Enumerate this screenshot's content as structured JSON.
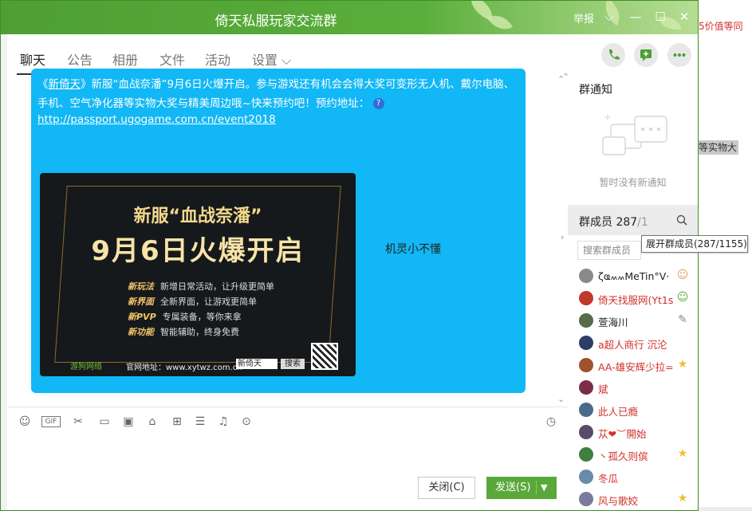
{
  "background": {
    "right_text": "5价值等同",
    "right_highlight": "等实物大"
  },
  "window": {
    "title": "倚天私服玩家交流群",
    "report_label": "举报",
    "controls": {
      "menu": "⌵",
      "minimize": "—",
      "maximize": "☐",
      "close": "✕"
    }
  },
  "tabs": [
    {
      "label": "聊天"
    },
    {
      "label": "公告"
    },
    {
      "label": "相册"
    },
    {
      "label": "文件"
    },
    {
      "label": "活动"
    },
    {
      "label": "设置 ⌵"
    }
  ],
  "message": {
    "text_prefix": "《",
    "game_name": "新倚天",
    "text_body": "》新服“血战奈潘”9月6日火爆开启。参与游戏还有机会会得大奖可变形无人机、戴尔电脑、手机、空气净化器等实物大奖与精美周边哦~快来预约吧！预约地址：",
    "link": "http://passport.ugogame.com.cn/event2018",
    "banner": {
      "headline": "新服“血战奈潘”",
      "subheadline": "9月6日火爆开启",
      "features": [
        {
          "name": "新玩法",
          "desc": "新增日常活动，让升级更简单"
        },
        {
          "name": "新界面",
          "desc": "全新界面，让游戏更简单"
        },
        {
          "name": "新PVP",
          "desc": "专属装备，等你来拿"
        },
        {
          "name": "新功能",
          "desc": "智能辅助，终身免费"
        }
      ],
      "brand": "游狗网络",
      "site": "官网地址：www.xytwz.com.cn",
      "search_value": "新倚天",
      "search_button": "搜索"
    },
    "sender": "机灵小不懂"
  },
  "composer": {
    "close_label": "关闭(C)",
    "send_label": "发送(S)",
    "tools": [
      "smile-icon",
      "gif-icon",
      "scissors-icon",
      "folder-icon",
      "image-icon",
      "store-icon",
      "gift-icon",
      "calendar-icon",
      "bell-icon",
      "more-icon"
    ]
  },
  "sidebar": {
    "notice_title": "群通知",
    "notice_empty": "暂时没有新通知",
    "member_title": "群成员 287",
    "member_count_suffix": "/1",
    "search_placeholder": "搜索群成员",
    "tooltip": "展开群成员(287/1155)",
    "members": [
      {
        "name": "ζҩ៳៳MeTin°V·",
        "color": "black",
        "avatar": "#8a8a8a",
        "badge": "owner"
      },
      {
        "name": "倚天找服网(Yt1s",
        "color": "red",
        "avatar": "#c0392b",
        "badge": "owner"
      },
      {
        "name": "萱海川",
        "color": "black",
        "avatar": "#556b4a",
        "badge": "edit"
      },
      {
        "name": "a超人商行 沉沦",
        "color": "red",
        "avatar": "#2c3e66",
        "badge": ""
      },
      {
        "name": "AA-雄安辉少拉=",
        "color": "red",
        "avatar": "#a0522d",
        "badge": "star"
      },
      {
        "name": "斌",
        "color": "red",
        "avatar": "#7a2e4a",
        "badge": ""
      },
      {
        "name": "此人已瘾",
        "color": "red",
        "avatar": "#4a6a8a",
        "badge": ""
      },
      {
        "name": "苁❤︶開始",
        "color": "red",
        "avatar": "#5a4a6a",
        "badge": ""
      },
      {
        "name": "丶孤久则傧",
        "color": "red",
        "avatar": "#3f7f3f",
        "badge": "star"
      },
      {
        "name": "冬瓜",
        "color": "red",
        "avatar": "#6a8aaa",
        "badge": ""
      },
      {
        "name": "风与歌姣",
        "color": "red",
        "avatar": "#7a7a9a",
        "badge": "star"
      }
    ]
  }
}
